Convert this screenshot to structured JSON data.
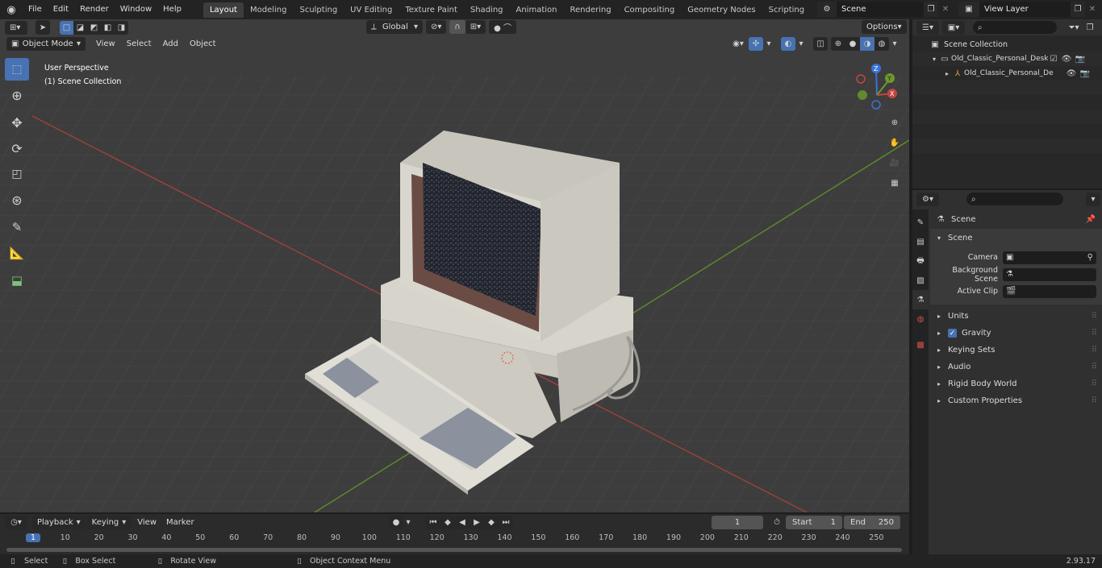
{
  "topbar": {
    "menus": [
      "File",
      "Edit",
      "Render",
      "Window",
      "Help"
    ],
    "workspaces": [
      "Layout",
      "Modeling",
      "Sculpting",
      "UV Editing",
      "Texture Paint",
      "Shading",
      "Animation",
      "Rendering",
      "Compositing",
      "Geometry Nodes",
      "Scripting"
    ],
    "active_workspace": "Layout",
    "add_tab": "+",
    "scene_name": "Scene",
    "view_layer": "View Layer"
  },
  "viewport": {
    "orientation": "Global",
    "options_label": "Options",
    "mode": "Object Mode",
    "menu": [
      "View",
      "Select",
      "Add",
      "Object"
    ],
    "perspective_label": "User Perspective",
    "collection_label": "(1) Scene Collection",
    "gizmo_axes": {
      "z": "Z",
      "y": "Y",
      "x": "X"
    }
  },
  "outliner": {
    "search_placeholder": "",
    "root": "Scene Collection",
    "items": [
      {
        "label": "Old_Classic_Personal_Desktop"
      },
      {
        "label": "Old_Classic_Personal_De"
      }
    ]
  },
  "properties": {
    "breadcrumb": "Scene",
    "section": "Scene",
    "fields": [
      {
        "label": "Camera",
        "value": ""
      },
      {
        "label": "Background Scene",
        "value": ""
      },
      {
        "label": "Active Clip",
        "value": ""
      }
    ],
    "panels": [
      "Units",
      "Gravity",
      "Keying Sets",
      "Audio",
      "Rigid Body World",
      "Custom Properties"
    ],
    "gravity_checked": true
  },
  "timeline": {
    "menus": [
      "Playback",
      "Keying",
      "View",
      "Marker"
    ],
    "current_frame": "1",
    "start_label": "Start",
    "start": "1",
    "end_label": "End",
    "end": "250",
    "ruler": [
      "1",
      "10",
      "20",
      "30",
      "40",
      "50",
      "60",
      "70",
      "80",
      "90",
      "100",
      "110",
      "120",
      "130",
      "140",
      "150",
      "160",
      "170",
      "180",
      "190",
      "200",
      "210",
      "220",
      "230",
      "240",
      "250"
    ]
  },
  "statusbar": {
    "select": "Select",
    "box_select": "Box Select",
    "rotate_view": "Rotate View",
    "context_menu": "Object Context Menu",
    "version": "2.93.17"
  },
  "colors": {
    "accent": "#4772b3",
    "x_axis": "#c4443f",
    "y_axis": "#6b9b2d",
    "z_axis": "#3a73d6",
    "viewport_bg": "#3d3d3d"
  }
}
